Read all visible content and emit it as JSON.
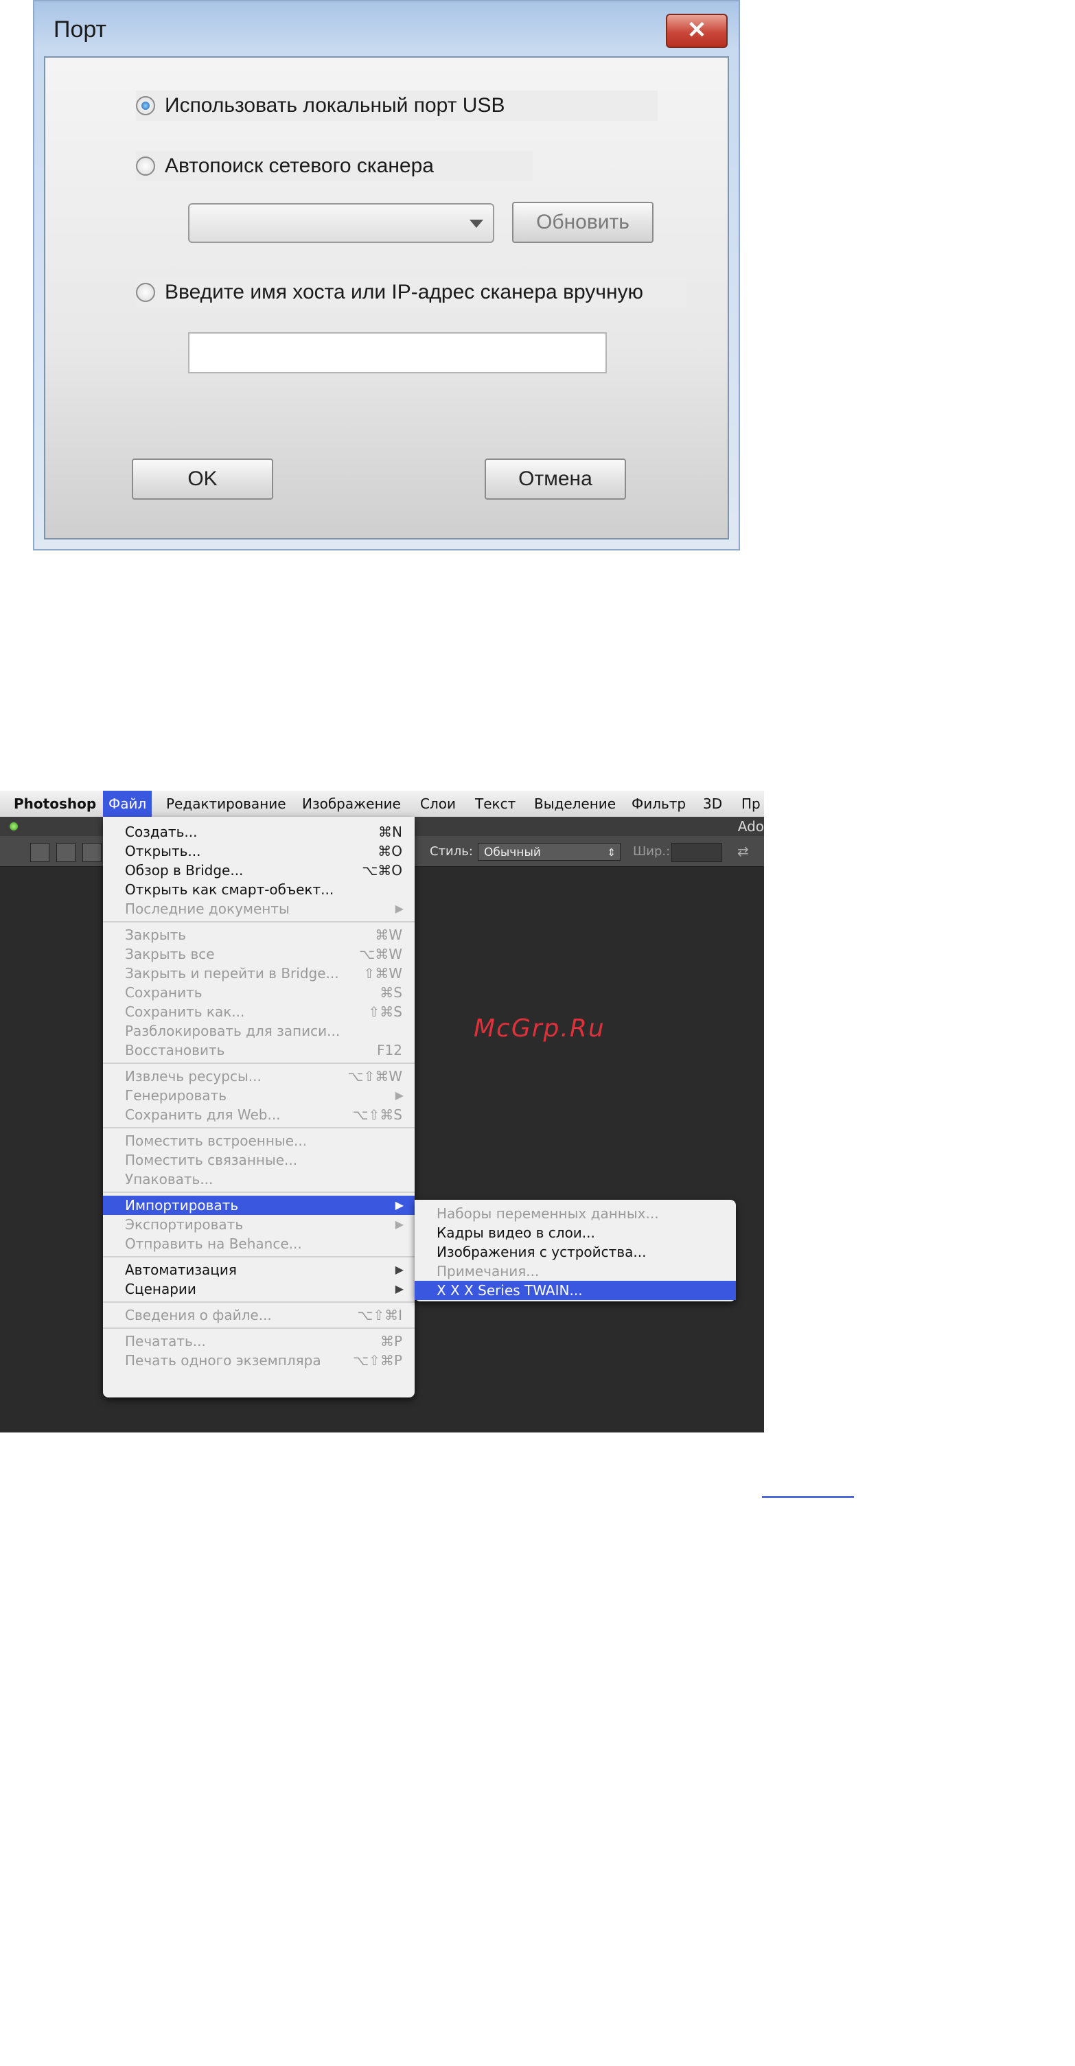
{
  "dialog": {
    "title": "Порт",
    "close_glyph": "✕",
    "radio_usb": "Использовать локальный порт USB",
    "radio_auto": "Автопоиск сетевого сканера",
    "refresh_button": "Обновить",
    "radio_manual": "Введите имя хоста или IP-адрес сканера вручную",
    "host_value": "",
    "ok_button": "OK",
    "cancel_button": "Отмена",
    "selected_radio": "usb"
  },
  "photoshop": {
    "menubar": [
      "Photoshop",
      "Файл",
      "Редактирование",
      "Изображение",
      "Слои",
      "Текст",
      "Выделение",
      "Фильтр",
      "3D",
      "Пр"
    ],
    "active_menu": "Файл",
    "window_title_fragment": "Ado",
    "options": {
      "style_label": "Стиль:",
      "style_value": "Обычный",
      "width_label": "Шир.:"
    },
    "file_menu": [
      {
        "label": "Создать...",
        "shortcut": "⌘N",
        "enabled": true
      },
      {
        "label": "Открыть...",
        "shortcut": "⌘O",
        "enabled": true
      },
      {
        "label": "Обзор в Bridge...",
        "shortcut": "⌥⌘O",
        "enabled": true
      },
      {
        "label": "Открыть как смарт-объект...",
        "shortcut": "",
        "enabled": true
      },
      {
        "label": "Последние документы",
        "shortcut": "",
        "enabled": false,
        "submenu": true
      },
      {
        "label": "Закрыть",
        "shortcut": "⌘W",
        "enabled": false
      },
      {
        "label": "Закрыть все",
        "shortcut": "⌥⌘W",
        "enabled": false
      },
      {
        "label": "Закрыть и перейти в Bridge...",
        "shortcut": "⇧⌘W",
        "enabled": false
      },
      {
        "label": "Сохранить",
        "shortcut": "⌘S",
        "enabled": false
      },
      {
        "label": "Сохранить как...",
        "shortcut": "⇧⌘S",
        "enabled": false
      },
      {
        "label": "Разблокировать для записи...",
        "shortcut": "",
        "enabled": false
      },
      {
        "label": "Восстановить",
        "shortcut": "F12",
        "enabled": false
      },
      {
        "label": "Извлечь ресурсы...",
        "shortcut": "⌥⇧⌘W",
        "enabled": false
      },
      {
        "label": "Генерировать",
        "shortcut": "",
        "enabled": false,
        "submenu": true
      },
      {
        "label": "Сохранить для Web...",
        "shortcut": "⌥⇧⌘S",
        "enabled": false
      },
      {
        "label": "Поместить встроенные...",
        "shortcut": "",
        "enabled": false
      },
      {
        "label": "Поместить связанные...",
        "shortcut": "",
        "enabled": false
      },
      {
        "label": "Упаковать...",
        "shortcut": "",
        "enabled": false
      },
      {
        "label": "Импортировать",
        "shortcut": "",
        "enabled": true,
        "submenu": true,
        "highlighted": true
      },
      {
        "label": "Экспортировать",
        "shortcut": "",
        "enabled": false,
        "submenu": true
      },
      {
        "label": "Отправить на Behance...",
        "shortcut": "",
        "enabled": false
      },
      {
        "label": "Автоматизация",
        "shortcut": "",
        "enabled": true,
        "submenu": true
      },
      {
        "label": "Сценарии",
        "shortcut": "",
        "enabled": true,
        "submenu": true
      },
      {
        "label": "Сведения о файле...",
        "shortcut": "⌥⇧⌘I",
        "enabled": false
      },
      {
        "label": "Печатать...",
        "shortcut": "⌘P",
        "enabled": false
      },
      {
        "label": "Печать одного экземпляра",
        "shortcut": "⌥⇧⌘P",
        "enabled": false
      }
    ],
    "import_submenu": [
      {
        "label": "Наборы переменных данных...",
        "enabled": false
      },
      {
        "label": "Кадры видео в слои...",
        "enabled": true
      },
      {
        "label": "Изображения с устройства...",
        "enabled": true
      },
      {
        "label": "Примечания...",
        "enabled": false
      },
      {
        "label": "X X X   Series TWAIN...",
        "enabled": true,
        "highlighted": true
      }
    ]
  },
  "watermark": "McGrp.Ru"
}
